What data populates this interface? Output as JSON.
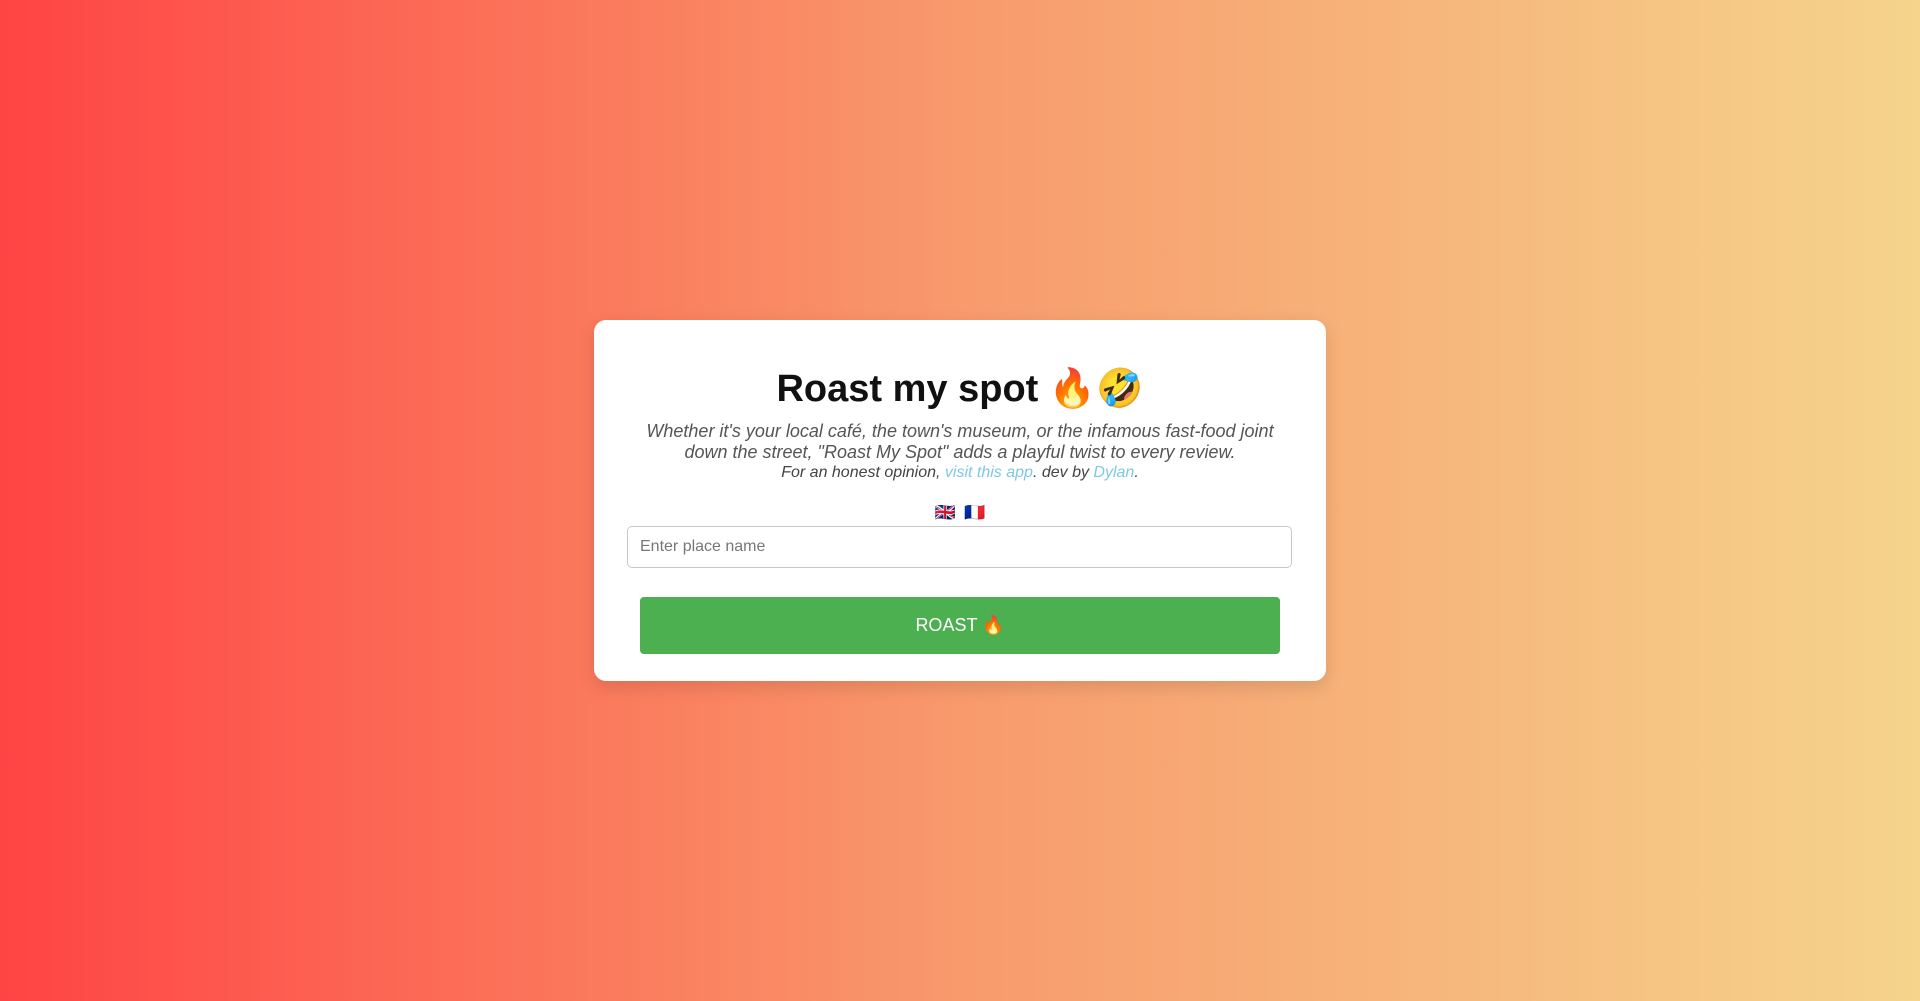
{
  "card": {
    "title": "Roast my spot 🔥🤣",
    "description": "Whether it's your local café, the town's museum, or the infamous fast-food joint down the street, \"Roast My Spot\" adds a playful twist to every review.",
    "honest": {
      "prefix": "For an honest opinion, ",
      "link_label": "visit this app",
      "middle": ". dev by ",
      "author_label": "Dylan",
      "suffix": "."
    },
    "languages": [
      {
        "flag": "🇬🇧",
        "icon": "uk-flag-icon"
      },
      {
        "flag": "🇫🇷",
        "icon": "france-flag-icon"
      }
    ],
    "input": {
      "placeholder": "Enter place name",
      "value": ""
    },
    "button_label": "ROAST 🔥"
  },
  "colors": {
    "gradient_start": "#ff4444",
    "gradient_end": "#f5d48c",
    "button": "#4caf50",
    "link": "#7ec8e3"
  }
}
